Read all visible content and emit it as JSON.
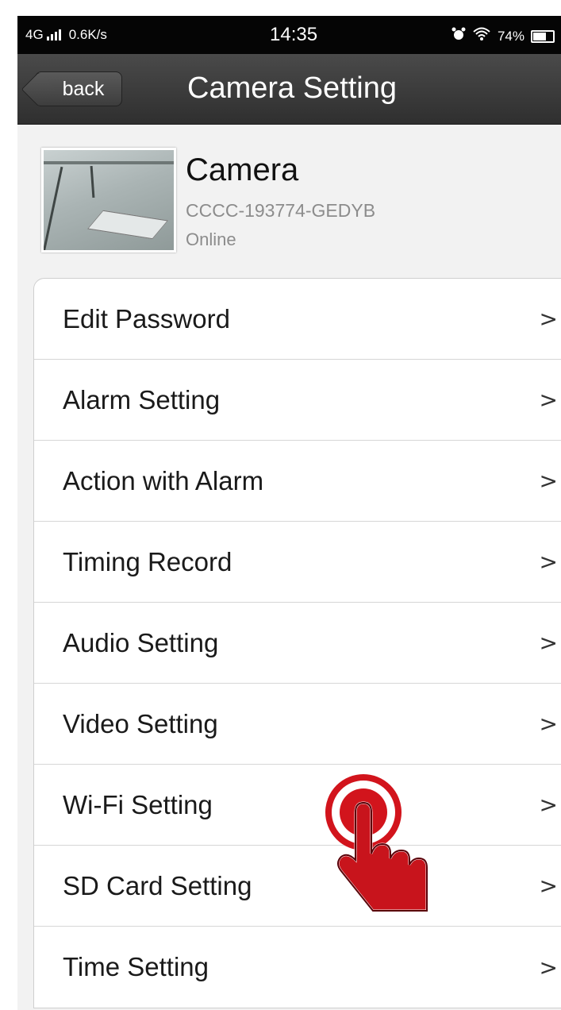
{
  "status_bar": {
    "network": "4G",
    "speed": "0.6K/s",
    "time": "14:35",
    "battery": "74%",
    "battery_level": 0.74
  },
  "nav": {
    "back_label": "back",
    "title": "Camera Setting"
  },
  "camera": {
    "name": "Camera",
    "id": "CCCC-193774-GEDYB",
    "status": "Online"
  },
  "settings": {
    "items": [
      {
        "label": "Edit Password",
        "chevron": ">"
      },
      {
        "label": "Alarm Setting",
        "chevron": ">"
      },
      {
        "label": "Action with Alarm",
        "chevron": ">"
      },
      {
        "label": "Timing Record",
        "chevron": ">"
      },
      {
        "label": "Audio Setting",
        "chevron": ">"
      },
      {
        "label": "Video Setting",
        "chevron": ">"
      },
      {
        "label": "Wi-Fi Setting",
        "chevron": ">"
      },
      {
        "label": "SD Card Setting",
        "chevron": ">"
      },
      {
        "label": "Time Setting",
        "chevron": ">"
      }
    ]
  },
  "colors": {
    "nav_bg": "#3a3a3a",
    "status_bg": "#050505",
    "tap_red": "#d2141c"
  }
}
